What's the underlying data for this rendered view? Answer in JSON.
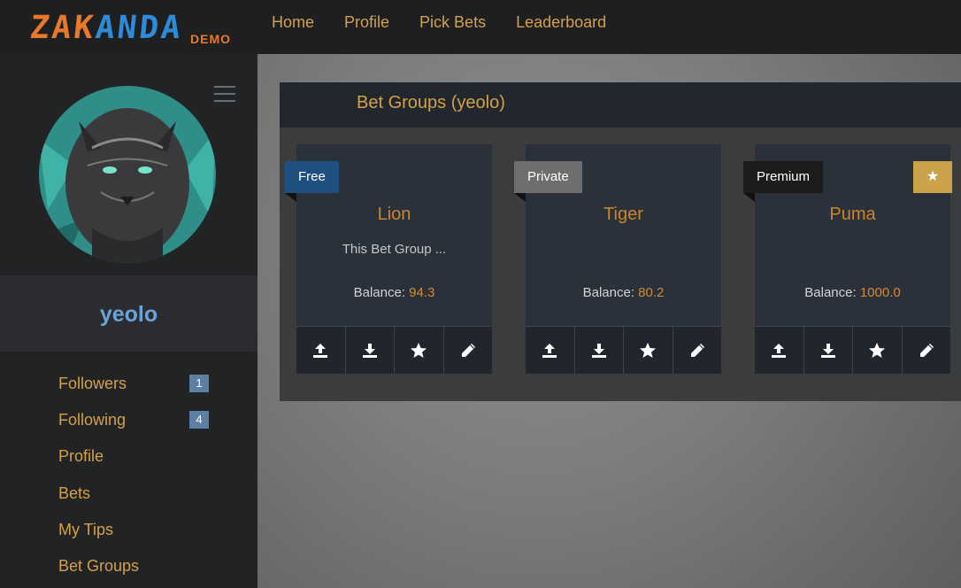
{
  "brand": {
    "part1": "ZAK",
    "part2": "ANDA",
    "suffix": "DEMO"
  },
  "nav": {
    "items": [
      "Home",
      "Profile",
      "Pick Bets",
      "Leaderboard"
    ]
  },
  "sidebar": {
    "username": "yeolo",
    "menu": [
      {
        "label": "Followers",
        "badge": "1"
      },
      {
        "label": "Following",
        "badge": "4"
      },
      {
        "label": "Profile"
      },
      {
        "label": "Bets"
      },
      {
        "label": "My Tips"
      },
      {
        "label": "Bet Groups"
      }
    ]
  },
  "panel": {
    "title": "Bet Groups (yeolo)"
  },
  "cards": [
    {
      "tag": "Free",
      "name": "Lion",
      "description": "This Bet Group ...",
      "balance_label": "Balance:",
      "balance": "94.3"
    },
    {
      "tag": "Private",
      "name": "Tiger",
      "description": "",
      "balance_label": "Balance:",
      "balance": "80.2"
    },
    {
      "tag": "Premium",
      "name": "Puma",
      "description": "",
      "balance_label": "Balance:",
      "balance": "1000.0"
    }
  ],
  "colors": {
    "accent": "#d4a04a",
    "username": "#6aa3d8",
    "badge": "#5d7fa3",
    "free": "#1f4f7f",
    "private": "#6e6e6e",
    "premium": "#1c1c1c",
    "star": "#c9a24a"
  }
}
